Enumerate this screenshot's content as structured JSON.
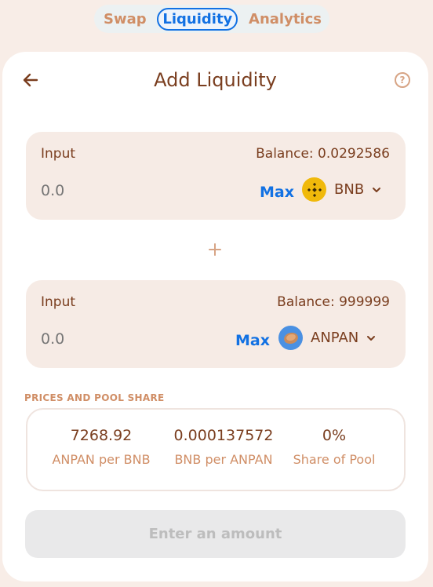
{
  "tabs": [
    {
      "label": "Swap"
    },
    {
      "label": "Liquidity"
    },
    {
      "label": "Analytics"
    }
  ],
  "card": {
    "title": "Add Liquidity"
  },
  "input1": {
    "label": "Input",
    "balance": "Balance: 0.0292586",
    "placeholder": "0.0",
    "max_label": "Max",
    "token": "BNB",
    "icon": "bnb-icon",
    "icon_color": "#f0b90b"
  },
  "input2": {
    "label": "Input",
    "balance": "Balance: 999999",
    "placeholder": "0.0",
    "max_label": "Max",
    "token": "ANPAN",
    "icon": "anpan-icon",
    "icon_color": "#4a90e2"
  },
  "prices": {
    "section_title": "PRICES AND POOL SHARE",
    "items": [
      {
        "value": "7268.92",
        "label": "ANPAN per BNB"
      },
      {
        "value": "0.000137572",
        "label": "BNB per ANPAN"
      },
      {
        "value": "0%",
        "label": "Share of Pool"
      }
    ]
  },
  "submit": {
    "label": "Enter an amount"
  },
  "colors": {
    "accent": "#1271e3",
    "brand_text": "#7a3e1f",
    "muted_orange": "#d08e66",
    "background": "#f8ede7"
  }
}
